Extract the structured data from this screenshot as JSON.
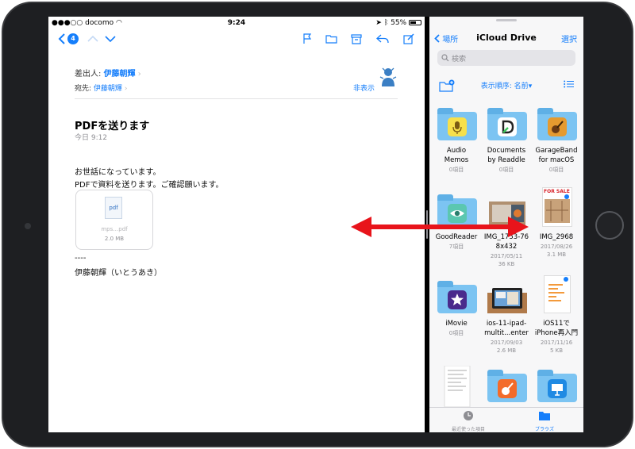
{
  "status": {
    "carrier": "docomo",
    "time": "9:24",
    "battery": "55%"
  },
  "mail": {
    "toolbar": {
      "unread_count": "4"
    },
    "from_label": "差出人:",
    "from_name": "伊藤朝輝",
    "to_label": "宛先:",
    "to_name": "伊藤朝輝",
    "hide_label": "非表示",
    "subject": "PDFを送ります",
    "date": "今日 9:12",
    "body_lines": [
      "お世話になっています。",
      "PDFで資料を送ります。ご確認願います。"
    ],
    "attachment": {
      "type_label": "pdf",
      "file_name": "mps…pdf",
      "size": "2.0 MB"
    },
    "signature_separator": "----",
    "signature": "伊藤朝輝（いとうあき）"
  },
  "files": {
    "back_label": "場所",
    "title": "iCloud Drive",
    "select_label": "選択",
    "search_placeholder": "検索",
    "sort_label": "表示順序: 名前",
    "items": [
      {
        "name_line1": "Audio",
        "name_line2": "Memos",
        "meta1": "0項目",
        "meta2": ""
      },
      {
        "name_line1": "Documents",
        "name_line2": "by Readdle",
        "meta1": "0項目",
        "meta2": ""
      },
      {
        "name_line1": "GarageBand",
        "name_line2": "for macOS",
        "meta1": "0項目",
        "meta2": ""
      },
      {
        "name_line1": "GoodReader",
        "name_line2": "",
        "meta1": "7項目",
        "meta2": ""
      },
      {
        "name_line1": "IMG_1753-76",
        "name_line2": "8x432",
        "meta1": "2017/05/11",
        "meta2": "36 KB"
      },
      {
        "name_line1": "IMG_2968",
        "name_line2": "",
        "meta1": "2017/08/26",
        "meta2": "3.1 MB"
      },
      {
        "name_line1": "iMovie",
        "name_line2": "",
        "meta1": "0項目",
        "meta2": ""
      },
      {
        "name_line1": "ios-11-ipad-",
        "name_line2": "multit...enter",
        "meta1": "2017/09/03",
        "meta2": "2.6 MB"
      },
      {
        "name_line1": "iOS11で",
        "name_line2": "iPhone再入門",
        "meta1": "2017/11/16",
        "meta2": "5 KB"
      }
    ],
    "thumb_text": {
      "for_sale": "FOR SALE"
    },
    "tabs": {
      "recents": "最近使った項目",
      "browse": "ブラウズ"
    }
  },
  "colors": {
    "accent": "#157efb",
    "arrow": "#e8141b",
    "folder": "#7cc4f2"
  }
}
